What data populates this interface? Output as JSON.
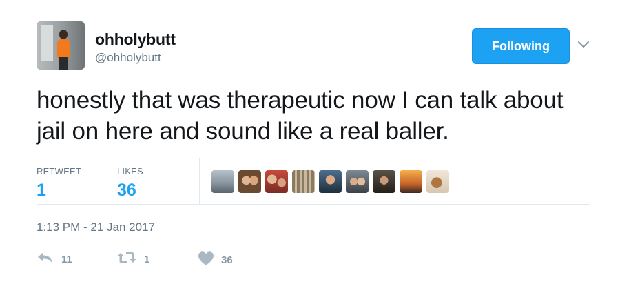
{
  "user": {
    "display_name": "ohholybutt",
    "handle": "@ohholybutt"
  },
  "follow_button": {
    "label": "Following",
    "color": "#1da1f2"
  },
  "tweet": {
    "text": "honestly that was therapeutic now I can talk about jail on here and sound like a real baller."
  },
  "stats": {
    "retweets_label": "RETWEET",
    "retweets_value": "1",
    "likes_label": "LIKES",
    "likes_value": "36",
    "liker_avatars": [
      "liker-avatar-1",
      "liker-avatar-2",
      "liker-avatar-3",
      "liker-avatar-4",
      "liker-avatar-5",
      "liker-avatar-6",
      "liker-avatar-7",
      "liker-avatar-8",
      "liker-avatar-9",
      "liker-avatar-10",
      "liker-avatar-11"
    ]
  },
  "timestamp": "1:13 PM - 21 Jan 2017",
  "actions": {
    "reply_count": "11",
    "retweet_count": "1",
    "like_count": "36",
    "icons": [
      "reply-icon",
      "retweet-icon",
      "heart-icon"
    ]
  },
  "colors": {
    "text": "#14171a",
    "muted": "#657786",
    "action_gray": "#aab8c2",
    "accent": "#1da1f2",
    "divider": "#e1e8ed"
  }
}
